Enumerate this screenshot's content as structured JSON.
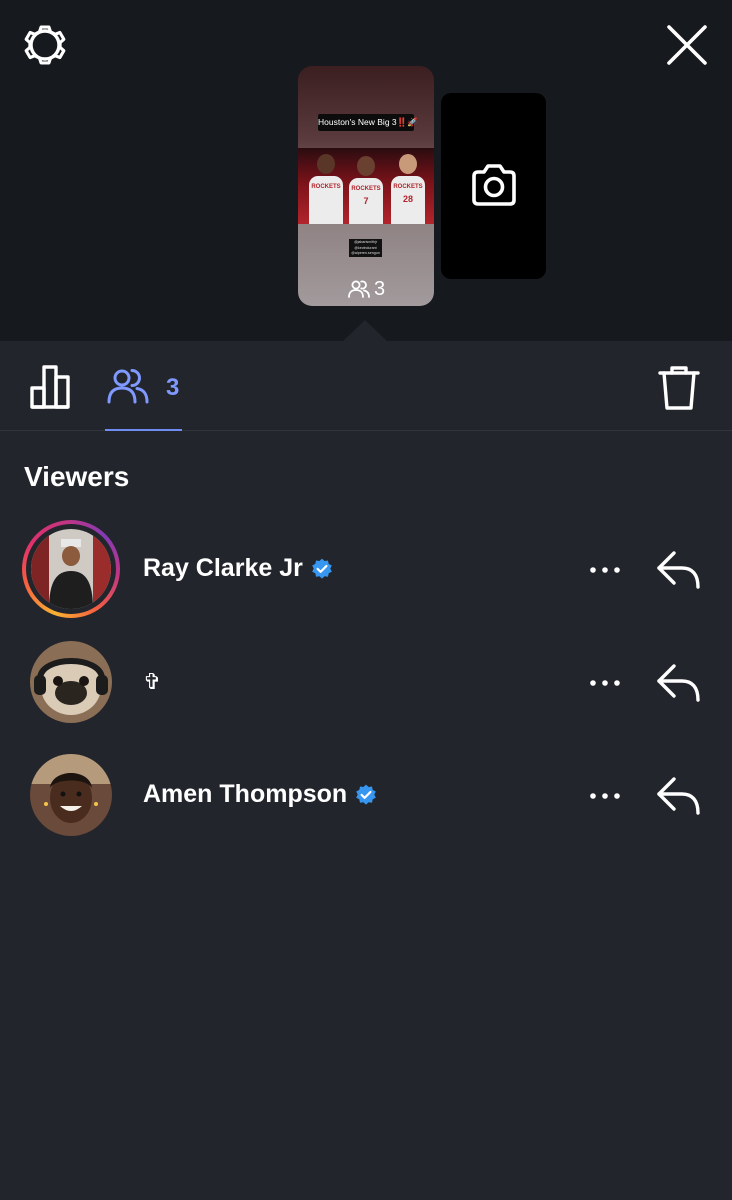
{
  "header": {
    "settings_icon": "gear-icon",
    "close_icon": "close-icon"
  },
  "story": {
    "caption": "Houston's New Big 3‼️🚀",
    "jersey_text": "ROCKETS",
    "jersey_numbers": [
      "",
      "7",
      "28"
    ],
    "tags": [
      "@jabarismithjr",
      "@kevindurant",
      "@alperen.sengun"
    ],
    "viewer_count": "3"
  },
  "tabs": {
    "viewers_count": "3"
  },
  "viewers_section": {
    "title": "Viewers"
  },
  "viewers": [
    {
      "name": "Ray Clarke Jr",
      "verified": true,
      "has_story_ring": true
    },
    {
      "name": "✞",
      "verified": false,
      "has_story_ring": false
    },
    {
      "name": "Amen Thompson",
      "verified": true,
      "has_story_ring": false
    }
  ],
  "colors": {
    "background": "#22252b",
    "top_background": "#16191e",
    "accent": "#7f99ff",
    "verified": "#3797f0"
  }
}
